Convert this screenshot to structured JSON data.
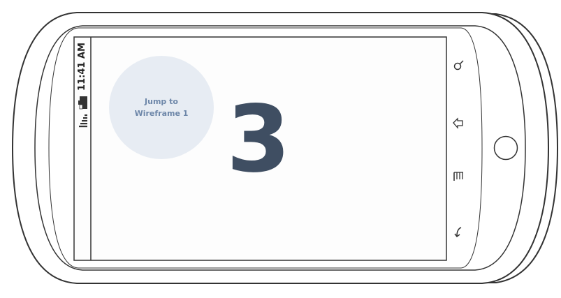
{
  "status_bar": {
    "time": "11:41 AM",
    "battery_icon": "battery-icon",
    "signal_icon": "signal-icon"
  },
  "jump_button": {
    "line1": "Jump to",
    "line2": "Wireframe 1"
  },
  "screen_number": "3",
  "hardware_buttons": [
    {
      "name": "search-icon"
    },
    {
      "name": "home-icon"
    },
    {
      "name": "menu-icon"
    },
    {
      "name": "back-icon"
    }
  ],
  "trackball": {
    "name": "trackball"
  },
  "colors": {
    "outline": "#333333",
    "circle_fill": "#e7ecf3",
    "circle_text": "#6e87a9",
    "number": "#3f4e62"
  }
}
